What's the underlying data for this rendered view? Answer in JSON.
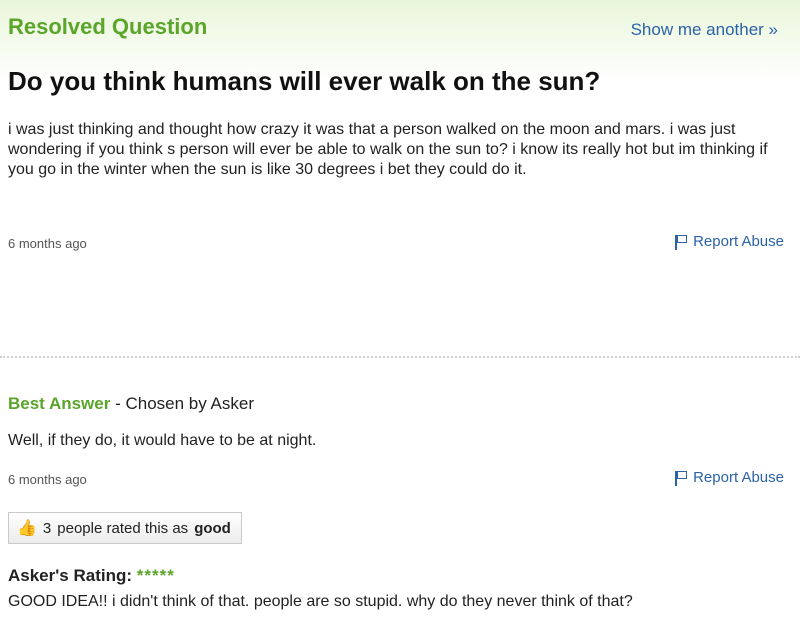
{
  "header": {
    "resolved_label": "Resolved Question",
    "show_another": "Show me another »"
  },
  "question": {
    "title": "Do you think humans will ever walk on the sun?",
    "body": "i was just thinking and thought how crazy it was that a person walked on the moon and mars. i was just wondering if you think s person will ever be able to walk on the sun to? i know its really hot but im thinking if you go in the winter when the sun is like 30 degrees i bet they could do it.",
    "timestamp": "6 months ago",
    "report_abuse": "Report Abuse"
  },
  "best_answer": {
    "label": "Best Answer",
    "chosen_by": " - Chosen by Asker",
    "text": "Well, if they do, it would have to be at night.",
    "timestamp": "6 months ago",
    "report_abuse": "Report Abuse",
    "rating_count": "3",
    "rating_text": "people rated this as",
    "rating_value": "good"
  },
  "asker_rating": {
    "label": "Asker's Rating:",
    "stars": "*****",
    "star_count": 5,
    "comment": "GOOD IDEA!! i didn't think of that. people are so stupid. why do they never think of that?"
  },
  "colors": {
    "accent_green": "#5aa52a",
    "link_blue": "#2b62a8"
  }
}
